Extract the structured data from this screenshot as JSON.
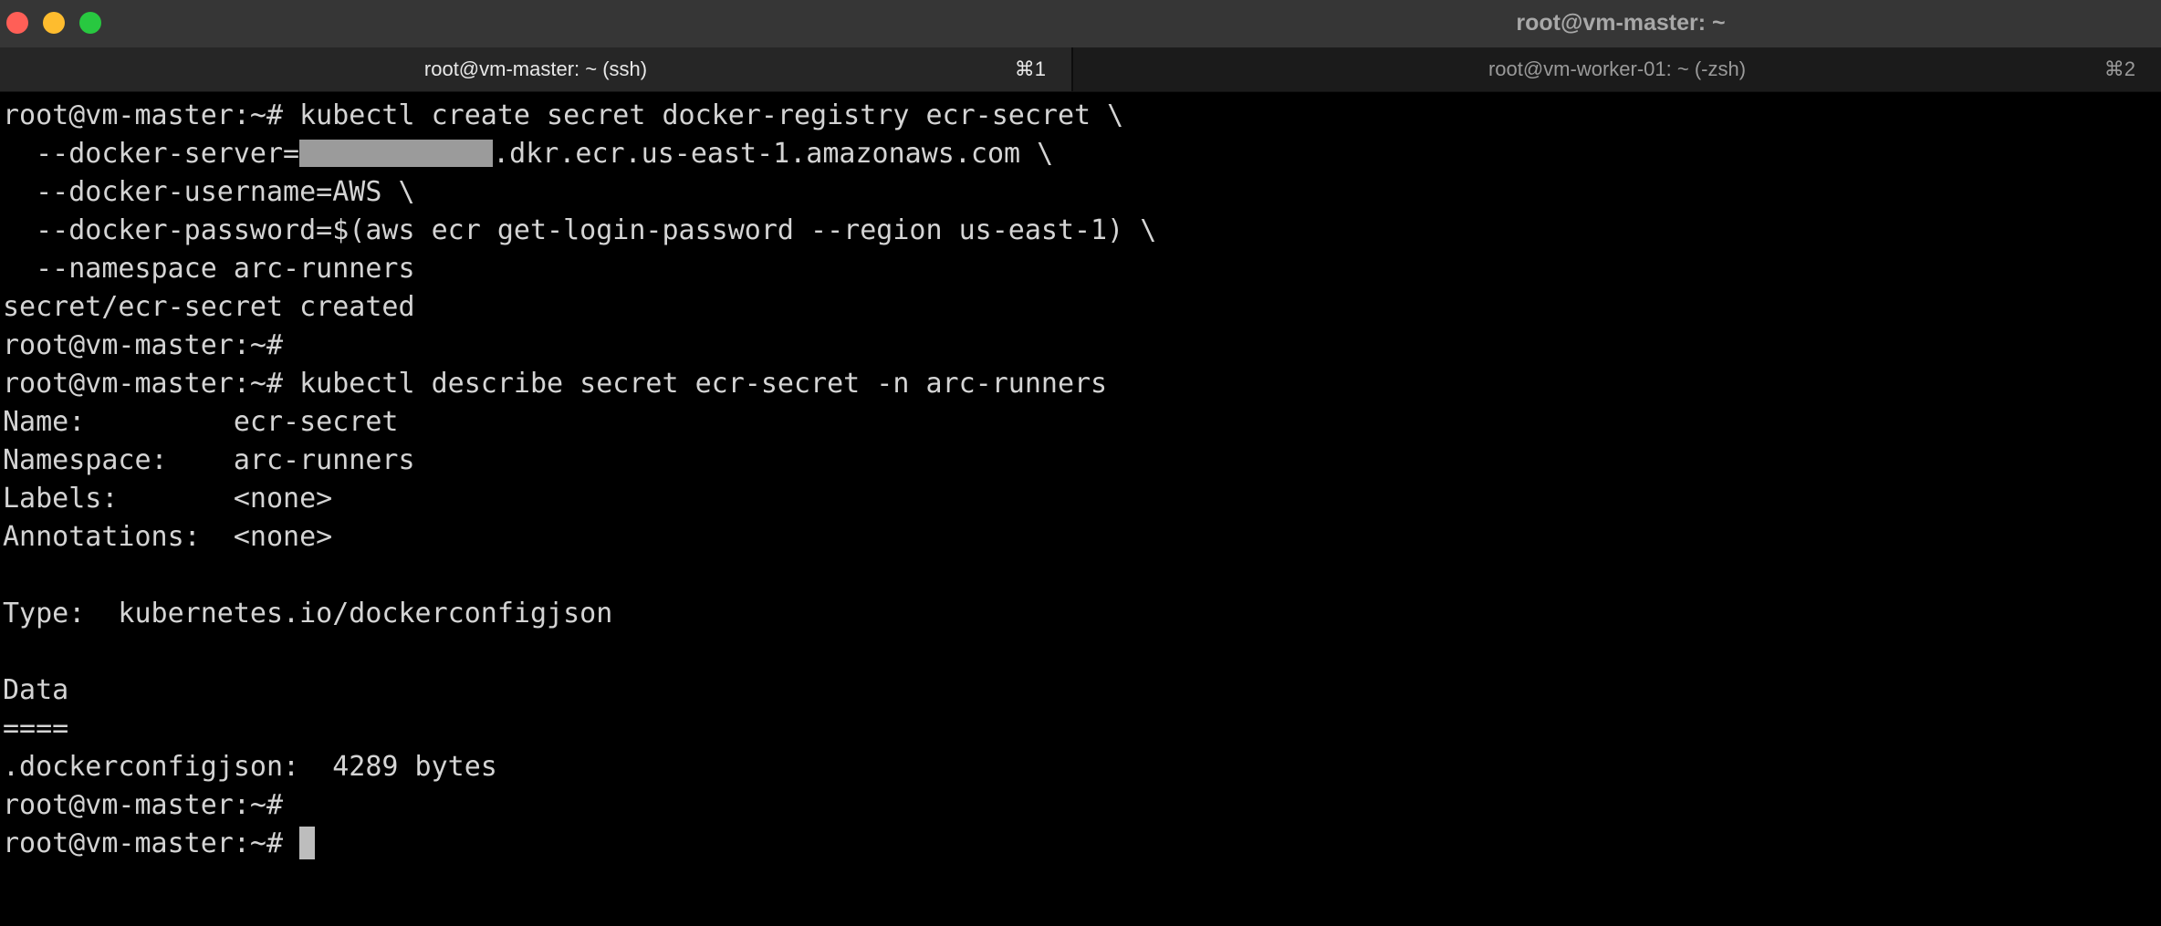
{
  "window": {
    "title": "root@vm-master: ~"
  },
  "tabs": [
    {
      "label": "root@vm-master: ~ (ssh)",
      "shortcut": "⌘1"
    },
    {
      "label": "root@vm-worker-01: ~ (-zsh)",
      "shortcut": "⌘2"
    }
  ],
  "colors": {
    "close": "#ff5f57",
    "minimize": "#febc2e",
    "zoom": "#28c840",
    "terminal_background": "#000000",
    "terminal_text": "#d4d4d4"
  },
  "terminal": {
    "lines": [
      "root@vm-master:~# kubectl create secret docker-registry ecr-secret \\",
      "  --docker-server=",
      "  --docker-username=AWS \\",
      "  --docker-password=$(aws ecr get-login-password --region us-east-1) \\",
      "  --namespace arc-runners",
      "secret/ecr-secret created",
      "root@vm-master:~#",
      "root@vm-master:~# kubectl describe secret ecr-secret -n arc-runners",
      "Name:         ecr-secret",
      "Namespace:    arc-runners",
      "Labels:       <none>",
      "Annotations:  <none>",
      "",
      "Type:  kubernetes.io/dockerconfigjson",
      "",
      "Data",
      "====",
      ".dockerconfigjson:  4289 bytes",
      "root@vm-master:~#",
      "root@vm-master:~# "
    ],
    "docker_server_suffix": ".dkr.ecr.us-east-1.amazonaws.com \\"
  }
}
